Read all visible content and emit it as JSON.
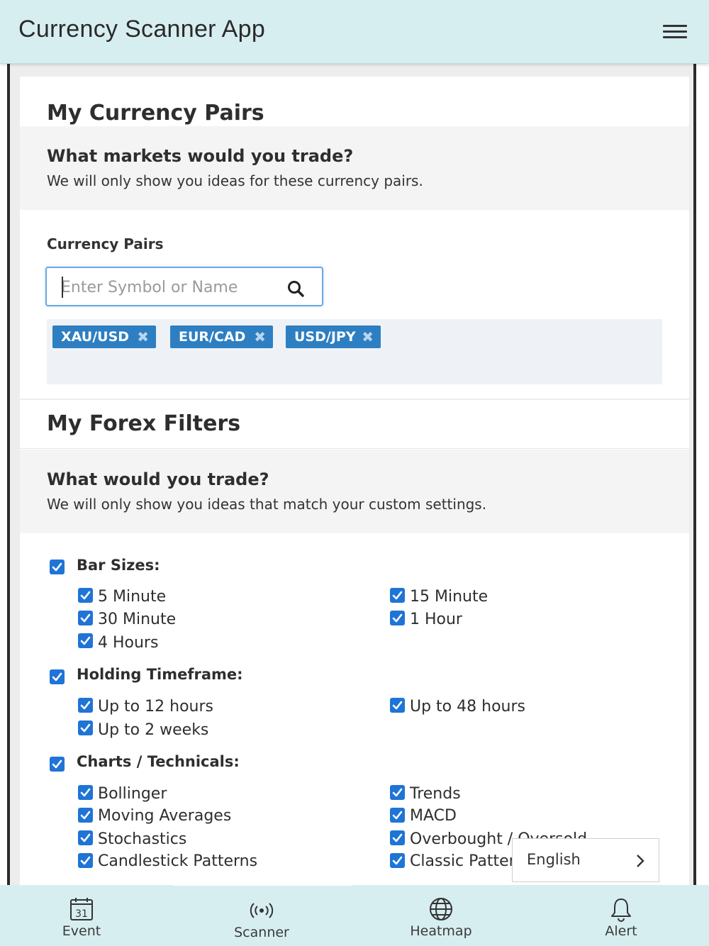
{
  "header": {
    "title": "Currency Scanner App"
  },
  "currency_pairs_card": {
    "title": "My Currency Pairs",
    "band_title": "What markets would you trade?",
    "band_subtitle": "We will only show you ideas for these currency pairs.",
    "field_label": "Currency Pairs",
    "search_placeholder": "Enter Symbol or Name",
    "tags": [
      "XAU/USD",
      "EUR/CAD",
      "USD/JPY"
    ]
  },
  "filters_card": {
    "title": "My Forex Filters",
    "band_title": "What would you trade?",
    "band_subtitle": "We will only show you ideas that match your custom settings.",
    "groups": [
      {
        "label": "Bar Sizes:",
        "checked": true,
        "options": [
          {
            "label": "5 Minute",
            "checked": true
          },
          {
            "label": "15 Minute",
            "checked": true
          },
          {
            "label": "30 Minute",
            "checked": true
          },
          {
            "label": "1 Hour",
            "checked": true
          },
          {
            "label": "4 Hours",
            "checked": true
          }
        ]
      },
      {
        "label": "Holding Timeframe:",
        "checked": true,
        "options": [
          {
            "label": "Up to 12 hours",
            "checked": true
          },
          {
            "label": "Up to 48 hours",
            "checked": true
          },
          {
            "label": "Up to 2 weeks",
            "checked": true
          }
        ]
      },
      {
        "label": "Charts / Technicals:",
        "checked": true,
        "options": [
          {
            "label": "Bollinger",
            "checked": true
          },
          {
            "label": "Trends",
            "checked": true
          },
          {
            "label": "Moving Averages",
            "checked": true
          },
          {
            "label": "MACD",
            "checked": true
          },
          {
            "label": "Stochastics",
            "checked": true
          },
          {
            "label": "Overbought / Oversold",
            "checked": true
          },
          {
            "label": "Candlestick Patterns",
            "checked": true
          },
          {
            "label": "Classic Patterns",
            "checked": true
          }
        ]
      }
    ]
  },
  "language_popup": {
    "label": "English"
  },
  "tabbar": {
    "tabs": [
      {
        "label": "Event",
        "icon": "calendar-icon",
        "calendar_day": "31"
      },
      {
        "label": "Scanner",
        "icon": "broadcast-icon",
        "active": true
      },
      {
        "label": "Heatmap",
        "icon": "globe-icon"
      },
      {
        "label": "Alert",
        "icon": "bell-icon"
      }
    ]
  },
  "colors": {
    "header_bg": "#d7eef1",
    "tag_bg": "#2d7fc2",
    "checkbox": "#1f74d6",
    "page_bg": "#ededed"
  }
}
